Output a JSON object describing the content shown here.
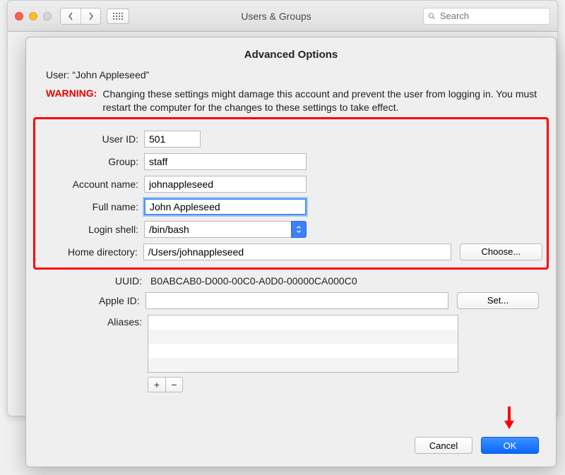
{
  "window": {
    "title": "Users & Groups",
    "search_placeholder": "Search"
  },
  "sheet": {
    "title": "Advanced Options",
    "user_label": "User:",
    "user_name": "“John Appleseed”",
    "warning_label": "WARNING:",
    "warning_text": "Changing these settings might damage this account and prevent the user from logging in. You must restart the computer for the changes to these settings to take effect.",
    "fields": {
      "user_id": {
        "label": "User ID:",
        "value": "501"
      },
      "group": {
        "label": "Group:",
        "value": "staff"
      },
      "account_name": {
        "label": "Account name:",
        "value": "johnappleseed"
      },
      "full_name": {
        "label": "Full name:",
        "value": "John Appleseed"
      },
      "login_shell": {
        "label": "Login shell:",
        "value": "/bin/bash"
      },
      "home_dir": {
        "label": "Home directory:",
        "value": "/Users/johnappleseed",
        "choose_label": "Choose..."
      },
      "uuid": {
        "label": "UUID:",
        "value": "B0ABCAB0-D000-00C0-A0D0-00000CA000C0"
      },
      "apple_id": {
        "label": "Apple ID:",
        "value": "",
        "set_label": "Set..."
      },
      "aliases": {
        "label": "Aliases:"
      }
    },
    "add_label": "+",
    "remove_label": "−",
    "cancel_label": "Cancel",
    "ok_label": "OK"
  }
}
